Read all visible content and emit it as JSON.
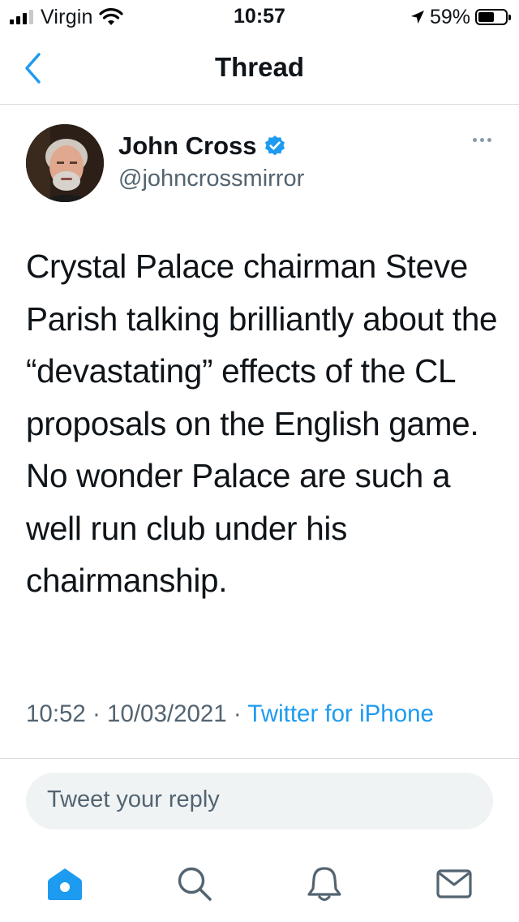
{
  "status_bar": {
    "carrier": "Virgin",
    "time": "10:57",
    "battery_percent": "59%",
    "battery_level": 0.59,
    "signal_bars_active": 3,
    "signal_bars_total": 4,
    "icons": [
      "signal-icon",
      "wifi-icon",
      "location-arrow-icon",
      "battery-icon"
    ]
  },
  "nav": {
    "title": "Thread",
    "back_icon": "chevron-left-icon",
    "accent_color": "#1d9bf0"
  },
  "tweet": {
    "author_name": "John Cross",
    "author_handle": "@johncrossmirror",
    "verified": true,
    "text": "Crystal Palace chairman Steve Parish talking brilliantly about the “devastating” effects of the CL proposals on the English game. No wonder Palace are such a well run club under his chairmanship.",
    "time": "10:52",
    "date": "10/03/2021",
    "separator": " · ",
    "source": "Twitter for iPhone",
    "more_icon": "more-dots-icon"
  },
  "reply": {
    "placeholder": "Tweet your reply"
  },
  "tab_bar": {
    "tabs": [
      {
        "icon": "home-icon",
        "active": true
      },
      {
        "icon": "search-icon",
        "active": false
      },
      {
        "icon": "bell-icon",
        "active": false
      },
      {
        "icon": "mail-icon",
        "active": false
      }
    ]
  },
  "colors": {
    "accent": "#1d9bf0",
    "secondary_text": "#536471",
    "divider": "#dcdcdc",
    "reply_bg": "#eff3f4"
  }
}
